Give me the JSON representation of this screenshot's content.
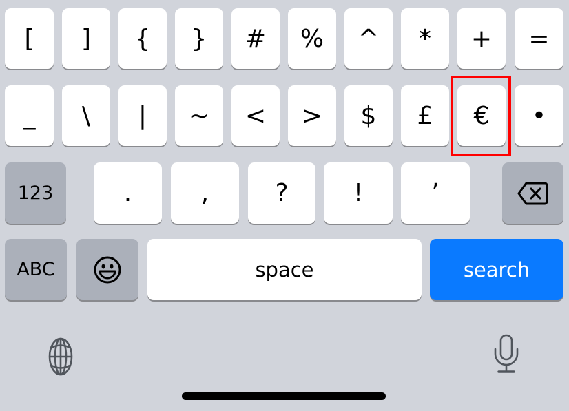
{
  "keyboard": {
    "row1": [
      "[",
      "]",
      "{",
      "}",
      "#",
      "%",
      "^",
      "*",
      "+",
      "="
    ],
    "row2": [
      "_",
      "\\",
      "|",
      "~",
      "<",
      ">",
      "$",
      "£",
      "€",
      "•"
    ],
    "row3": {
      "mode_key": "123",
      "keys": [
        ".",
        ",",
        "?",
        "!",
        "’"
      ],
      "delete_icon": "delete-backspace-icon"
    },
    "row4": {
      "abc_key": "ABC",
      "emoji_icon": "emoji-smiley-icon",
      "space_label": "space",
      "action_label": "search"
    },
    "bottom": {
      "globe_icon": "globe-icon",
      "mic_icon": "microphone-icon"
    },
    "highlighted_key": "€",
    "colors": {
      "background": "#d1d4db",
      "key": "#ffffff",
      "function_key": "#abb0ba",
      "action_key": "#0a7aff",
      "highlight": "#ff0000"
    }
  }
}
